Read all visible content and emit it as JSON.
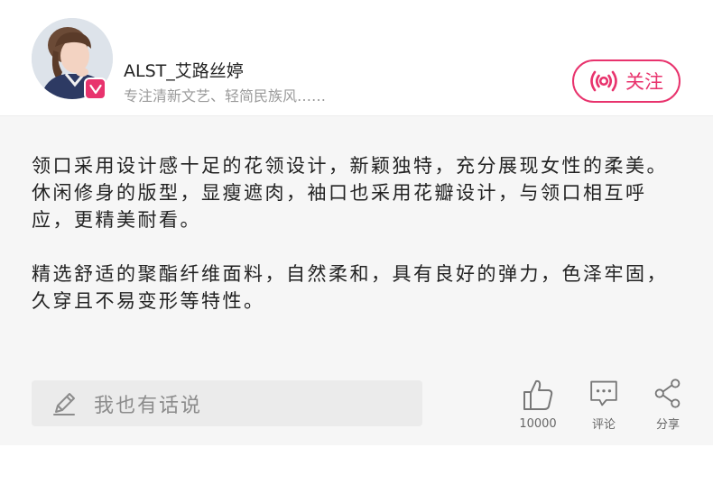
{
  "author": {
    "name": "ALST_艾路丝婷",
    "description": "专注清新文艺、轻简民族风……",
    "avatar_icon": "avatar-photo",
    "verified_icon": "v-badge-icon"
  },
  "follow": {
    "label": "关注",
    "icon": "broadcast-icon"
  },
  "content": {
    "paragraph_1": "领口采用设计感十足的花领设计，新颖独特，充分展现女性的柔美。休闲修身的版型，显瘦遮肉，袖口也采用花瓣设计，与领口相互呼应，更精美耐看。",
    "paragraph_2": "精选舒适的聚酯纤维面料，自然柔和，具有良好的弹力，色泽牢固，久穿且不易变形等特性。"
  },
  "comment_input": {
    "placeholder": "我也有话说",
    "icon": "pencil-icon"
  },
  "actions": {
    "like_count": "10000",
    "comment_label": "评论",
    "share_label": "分享"
  },
  "colors": {
    "accent": "#e8336d",
    "content_bg": "#f6f6f6",
    "input_bg": "#ebebeb",
    "muted_text": "#9a9a9a"
  }
}
